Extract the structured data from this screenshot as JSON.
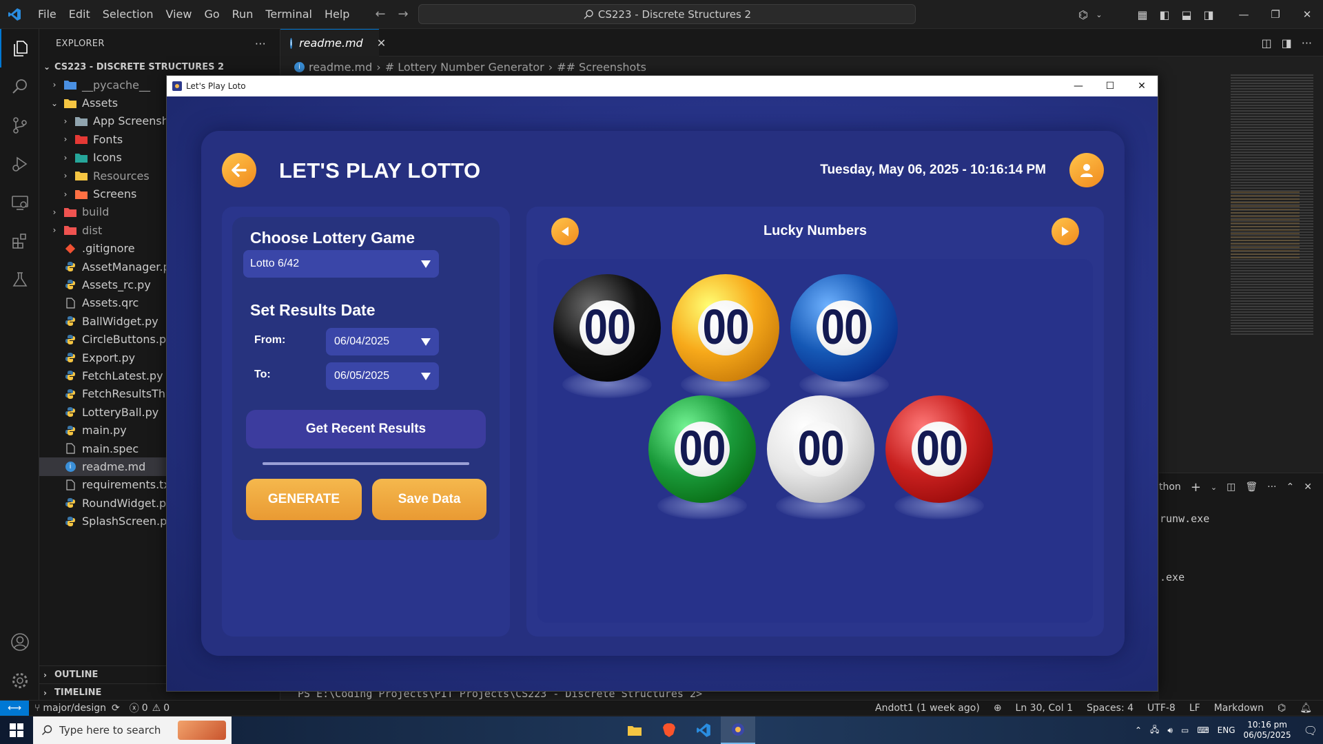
{
  "vscode": {
    "menu": [
      "File",
      "Edit",
      "Selection",
      "View",
      "Go",
      "Run",
      "Terminal",
      "Help"
    ],
    "search_title": "CS223 - Discrete Structures 2",
    "explorer_label": "EXPLORER",
    "explorer_more": "···",
    "root_folder": "CS223 - DISCRETE STRUCTURES 2",
    "tree": [
      {
        "label": "__pycache__",
        "chev": "›",
        "indent": 1
      },
      {
        "label": "Assets",
        "chev": "⌄",
        "indent": 1
      },
      {
        "label": "App Screenshots",
        "chev": "›",
        "indent": 2
      },
      {
        "label": "Fonts",
        "chev": "›",
        "indent": 2
      },
      {
        "label": "Icons",
        "chev": "›",
        "indent": 2
      },
      {
        "label": "Resources",
        "chev": "›",
        "indent": 2
      },
      {
        "label": "Screens",
        "chev": "›",
        "indent": 2
      },
      {
        "label": "build",
        "chev": "›",
        "indent": 1
      },
      {
        "label": "dist",
        "chev": "›",
        "indent": 1
      },
      {
        "label": ".gitignore",
        "chev": "",
        "indent": 1
      },
      {
        "label": "AssetManager.py",
        "chev": "",
        "indent": 1
      },
      {
        "label": "Assets_rc.py",
        "chev": "",
        "indent": 1
      },
      {
        "label": "Assets.qrc",
        "chev": "",
        "indent": 1
      },
      {
        "label": "BallWidget.py",
        "chev": "",
        "indent": 1
      },
      {
        "label": "CircleButtons.py",
        "chev": "",
        "indent": 1
      },
      {
        "label": "Export.py",
        "chev": "",
        "indent": 1
      },
      {
        "label": "FetchLatest.py",
        "chev": "",
        "indent": 1
      },
      {
        "label": "FetchResultsThread.py",
        "chev": "",
        "indent": 1
      },
      {
        "label": "LotteryBall.py",
        "chev": "",
        "indent": 1
      },
      {
        "label": "main.py",
        "chev": "",
        "indent": 1
      },
      {
        "label": "main.spec",
        "chev": "",
        "indent": 1
      },
      {
        "label": "readme.md",
        "chev": "",
        "indent": 1
      },
      {
        "label": "requirements.txt",
        "chev": "",
        "indent": 1
      },
      {
        "label": "RoundWidget.py",
        "chev": "",
        "indent": 1
      },
      {
        "label": "SplashScreen.py",
        "chev": "",
        "indent": 1
      }
    ],
    "outline_label": "OUTLINE",
    "timeline_label": "TIMELINE",
    "tab_label": "readme.md",
    "breadcrumb": [
      "readme.md",
      "# Lottery Number Generator",
      "## Screenshots"
    ],
    "panel_label": "thon",
    "terminal_lines": [
      "runw.exe",
      ".exe"
    ],
    "terminal_prompt": "PS E:\\Coding Projects\\PIT Projects\\CS223 - Discrete Structures 2> ",
    "status": {
      "branch": "major/design",
      "errors": "0",
      "warnings": "0",
      "blame": "Andott1 (1 week ago)",
      "position": "Ln 30, Col 1",
      "spaces": "Spaces: 4",
      "encoding": "UTF-8",
      "eol": "LF",
      "language": "Markdown"
    }
  },
  "taskbar": {
    "search_placeholder": "Type here to search",
    "lang": "ENG",
    "time": "10:16 pm",
    "date": "06/05/2025"
  },
  "app": {
    "window_title": "Let's Play Loto",
    "heading": "LET'S PLAY LOTTO",
    "datetime": "Tuesday, May 06, 2025 - 10:16:14 PM",
    "choose_game_title": "Choose Lottery Game",
    "game_selected": "Lotto 6/42",
    "results_date_title": "Set Results Date",
    "from_label": "From:",
    "from_value": "06/04/2025",
    "to_label": "To:",
    "to_value": "06/05/2025",
    "recent_button": "Get Recent Results",
    "progress": 1.0,
    "generate_button": "GENERATE",
    "save_button": "Save Data",
    "lucky_title": "Lucky Numbers",
    "balls": [
      {
        "number": "00",
        "color": "#111111"
      },
      {
        "number": "00",
        "color": "#f7a91a"
      },
      {
        "number": "00",
        "color": "#1558b5"
      },
      {
        "number": "00",
        "color": "#1a9a3a"
      },
      {
        "number": "00",
        "color": "#e6e6e6"
      },
      {
        "number": "00",
        "color": "#c8201f"
      }
    ]
  }
}
